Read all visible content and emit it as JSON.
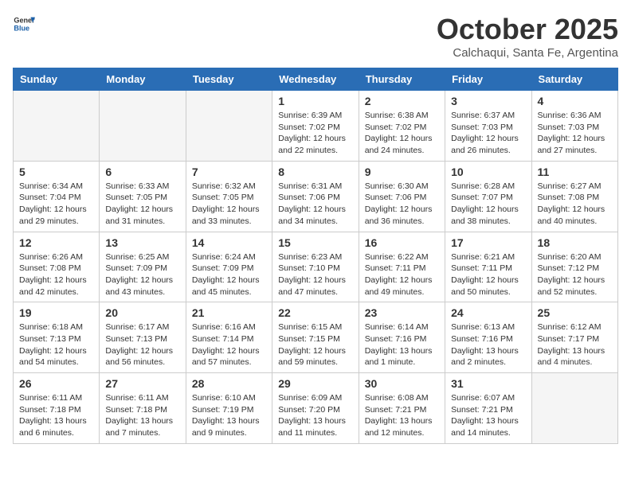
{
  "header": {
    "logo_general": "General",
    "logo_blue": "Blue",
    "month_title": "October 2025",
    "location": "Calchaqui, Santa Fe, Argentina"
  },
  "weekdays": [
    "Sunday",
    "Monday",
    "Tuesday",
    "Wednesday",
    "Thursday",
    "Friday",
    "Saturday"
  ],
  "weeks": [
    [
      {
        "day": "",
        "info": ""
      },
      {
        "day": "",
        "info": ""
      },
      {
        "day": "",
        "info": ""
      },
      {
        "day": "1",
        "info": "Sunrise: 6:39 AM\nSunset: 7:02 PM\nDaylight: 12 hours\nand 22 minutes."
      },
      {
        "day": "2",
        "info": "Sunrise: 6:38 AM\nSunset: 7:02 PM\nDaylight: 12 hours\nand 24 minutes."
      },
      {
        "day": "3",
        "info": "Sunrise: 6:37 AM\nSunset: 7:03 PM\nDaylight: 12 hours\nand 26 minutes."
      },
      {
        "day": "4",
        "info": "Sunrise: 6:36 AM\nSunset: 7:03 PM\nDaylight: 12 hours\nand 27 minutes."
      }
    ],
    [
      {
        "day": "5",
        "info": "Sunrise: 6:34 AM\nSunset: 7:04 PM\nDaylight: 12 hours\nand 29 minutes."
      },
      {
        "day": "6",
        "info": "Sunrise: 6:33 AM\nSunset: 7:05 PM\nDaylight: 12 hours\nand 31 minutes."
      },
      {
        "day": "7",
        "info": "Sunrise: 6:32 AM\nSunset: 7:05 PM\nDaylight: 12 hours\nand 33 minutes."
      },
      {
        "day": "8",
        "info": "Sunrise: 6:31 AM\nSunset: 7:06 PM\nDaylight: 12 hours\nand 34 minutes."
      },
      {
        "day": "9",
        "info": "Sunrise: 6:30 AM\nSunset: 7:06 PM\nDaylight: 12 hours\nand 36 minutes."
      },
      {
        "day": "10",
        "info": "Sunrise: 6:28 AM\nSunset: 7:07 PM\nDaylight: 12 hours\nand 38 minutes."
      },
      {
        "day": "11",
        "info": "Sunrise: 6:27 AM\nSunset: 7:08 PM\nDaylight: 12 hours\nand 40 minutes."
      }
    ],
    [
      {
        "day": "12",
        "info": "Sunrise: 6:26 AM\nSunset: 7:08 PM\nDaylight: 12 hours\nand 42 minutes."
      },
      {
        "day": "13",
        "info": "Sunrise: 6:25 AM\nSunset: 7:09 PM\nDaylight: 12 hours\nand 43 minutes."
      },
      {
        "day": "14",
        "info": "Sunrise: 6:24 AM\nSunset: 7:09 PM\nDaylight: 12 hours\nand 45 minutes."
      },
      {
        "day": "15",
        "info": "Sunrise: 6:23 AM\nSunset: 7:10 PM\nDaylight: 12 hours\nand 47 minutes."
      },
      {
        "day": "16",
        "info": "Sunrise: 6:22 AM\nSunset: 7:11 PM\nDaylight: 12 hours\nand 49 minutes."
      },
      {
        "day": "17",
        "info": "Sunrise: 6:21 AM\nSunset: 7:11 PM\nDaylight: 12 hours\nand 50 minutes."
      },
      {
        "day": "18",
        "info": "Sunrise: 6:20 AM\nSunset: 7:12 PM\nDaylight: 12 hours\nand 52 minutes."
      }
    ],
    [
      {
        "day": "19",
        "info": "Sunrise: 6:18 AM\nSunset: 7:13 PM\nDaylight: 12 hours\nand 54 minutes."
      },
      {
        "day": "20",
        "info": "Sunrise: 6:17 AM\nSunset: 7:13 PM\nDaylight: 12 hours\nand 56 minutes."
      },
      {
        "day": "21",
        "info": "Sunrise: 6:16 AM\nSunset: 7:14 PM\nDaylight: 12 hours\nand 57 minutes."
      },
      {
        "day": "22",
        "info": "Sunrise: 6:15 AM\nSunset: 7:15 PM\nDaylight: 12 hours\nand 59 minutes."
      },
      {
        "day": "23",
        "info": "Sunrise: 6:14 AM\nSunset: 7:16 PM\nDaylight: 13 hours\nand 1 minute."
      },
      {
        "day": "24",
        "info": "Sunrise: 6:13 AM\nSunset: 7:16 PM\nDaylight: 13 hours\nand 2 minutes."
      },
      {
        "day": "25",
        "info": "Sunrise: 6:12 AM\nSunset: 7:17 PM\nDaylight: 13 hours\nand 4 minutes."
      }
    ],
    [
      {
        "day": "26",
        "info": "Sunrise: 6:11 AM\nSunset: 7:18 PM\nDaylight: 13 hours\nand 6 minutes."
      },
      {
        "day": "27",
        "info": "Sunrise: 6:11 AM\nSunset: 7:18 PM\nDaylight: 13 hours\nand 7 minutes."
      },
      {
        "day": "28",
        "info": "Sunrise: 6:10 AM\nSunset: 7:19 PM\nDaylight: 13 hours\nand 9 minutes."
      },
      {
        "day": "29",
        "info": "Sunrise: 6:09 AM\nSunset: 7:20 PM\nDaylight: 13 hours\nand 11 minutes."
      },
      {
        "day": "30",
        "info": "Sunrise: 6:08 AM\nSunset: 7:21 PM\nDaylight: 13 hours\nand 12 minutes."
      },
      {
        "day": "31",
        "info": "Sunrise: 6:07 AM\nSunset: 7:21 PM\nDaylight: 13 hours\nand 14 minutes."
      },
      {
        "day": "",
        "info": ""
      }
    ]
  ]
}
